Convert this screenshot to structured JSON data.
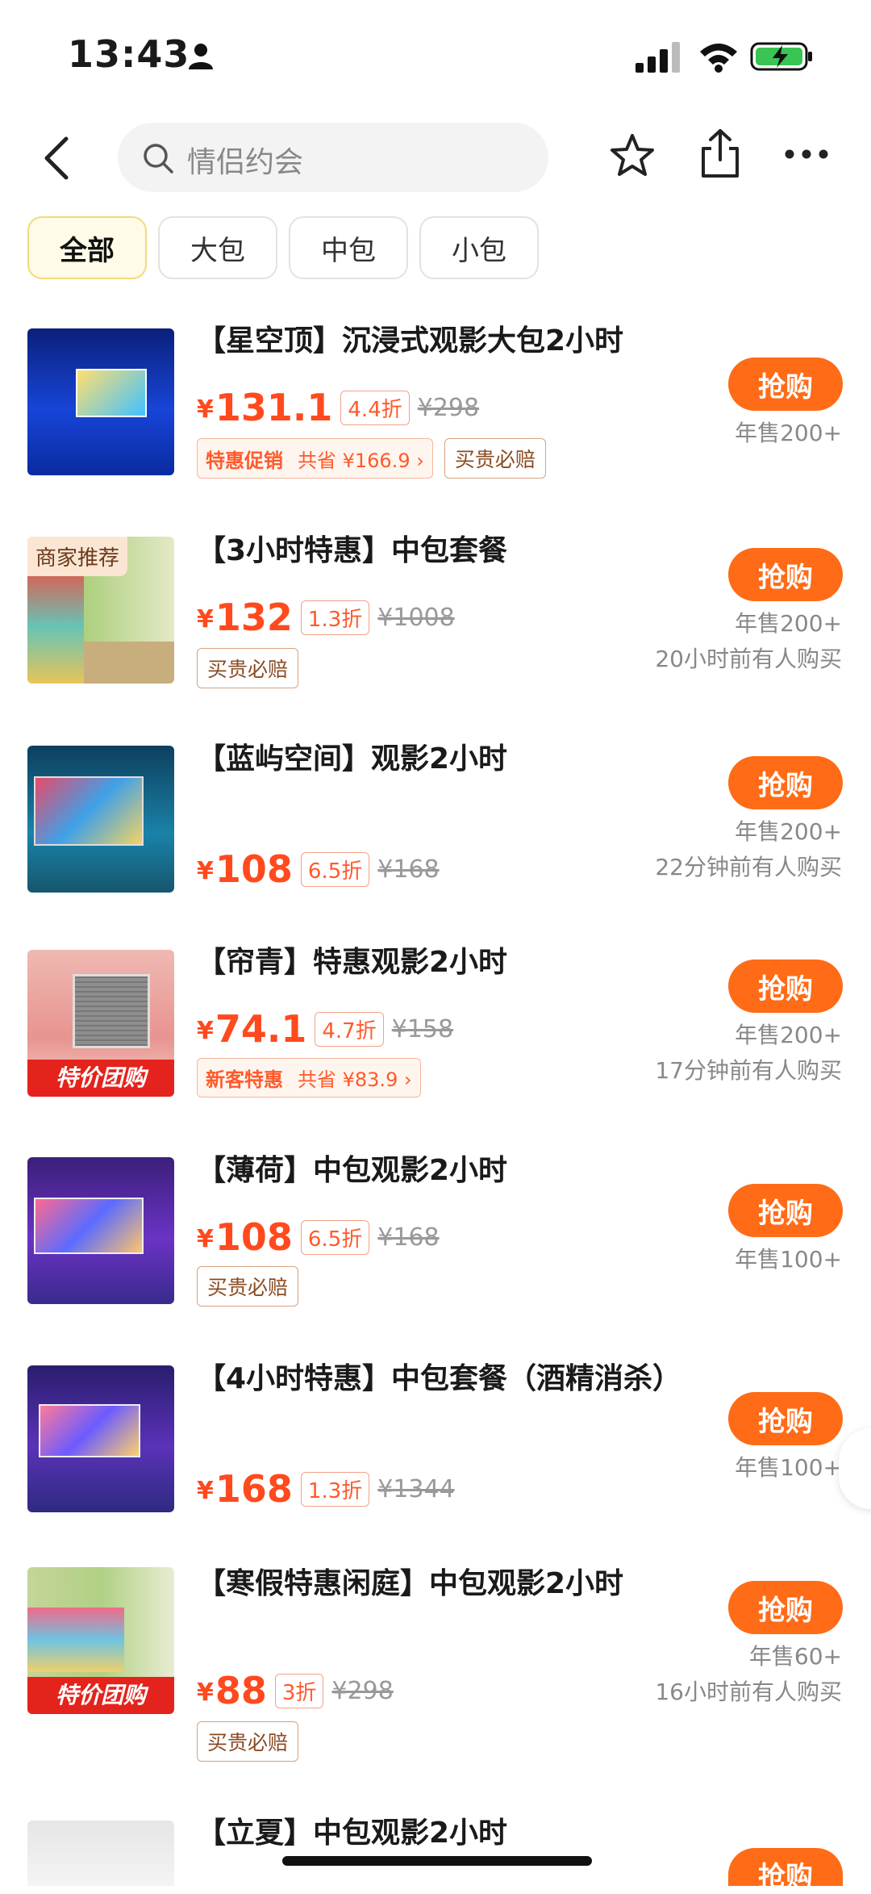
{
  "status": {
    "time": "13:43"
  },
  "search": {
    "placeholder": "情侣约会"
  },
  "tabs": [
    {
      "label": "全部",
      "active": true
    },
    {
      "label": "大包",
      "active": false
    },
    {
      "label": "中包",
      "active": false
    },
    {
      "label": "小包",
      "active": false
    }
  ],
  "items": [
    {
      "title": "【星空顶】沉浸式观影大包2小时",
      "yen": "¥",
      "price": "131.1",
      "discount": "4.4折",
      "original": "¥298",
      "promo": {
        "name": "特惠促销",
        "save": "共省 ¥166.9 ›"
      },
      "badge": "买贵必赔",
      "buy": "抢购",
      "sold": "年售200+",
      "recent": ""
    },
    {
      "title": "【3小时特惠】中包套餐",
      "yen": "¥",
      "price": "132",
      "discount": "1.3折",
      "original": "¥1008",
      "badge": "买贵必赔",
      "buy": "抢购",
      "sold": "年售200+",
      "recent": "20小时前有人购买",
      "thumb_tag": "商家推荐"
    },
    {
      "title": "【蓝屿空间】观影2小时",
      "yen": "¥",
      "price": "108",
      "discount": "6.5折",
      "original": "¥168",
      "buy": "抢购",
      "sold": "年售200+",
      "recent": "22分钟前有人购买"
    },
    {
      "title": "【帘青】特惠观影2小时",
      "yen": "¥",
      "price": "74.1",
      "discount": "4.7折",
      "original": "¥158",
      "promo": {
        "name": "新客特惠",
        "save": "共省 ¥83.9 ›"
      },
      "buy": "抢购",
      "sold": "年售200+",
      "recent": "17分钟前有人购买",
      "thumb_bottom": "特价团购"
    },
    {
      "title": "【薄荷】中包观影2小时",
      "yen": "¥",
      "price": "108",
      "discount": "6.5折",
      "original": "¥168",
      "badge": "买贵必赔",
      "buy": "抢购",
      "sold": "年售100+"
    },
    {
      "title": "【4小时特惠】中包套餐（酒精消杀）",
      "yen": "¥",
      "price": "168",
      "discount": "1.3折",
      "original": "¥1344",
      "buy": "抢购",
      "sold": "年售100+"
    },
    {
      "title": "【寒假特惠闲庭】中包观影2小时",
      "yen": "¥",
      "price": "88",
      "discount": "3折",
      "original": "¥298",
      "badge": "买贵必赔",
      "buy": "抢购",
      "sold": "年售60+",
      "recent": "16小时前有人购买",
      "thumb_bottom": "特价团购"
    },
    {
      "title": "【立夏】中包观影2小时",
      "buy": "抢购"
    }
  ],
  "colors": {
    "accent": "#ff6b16",
    "price": "#ff4a1e"
  }
}
